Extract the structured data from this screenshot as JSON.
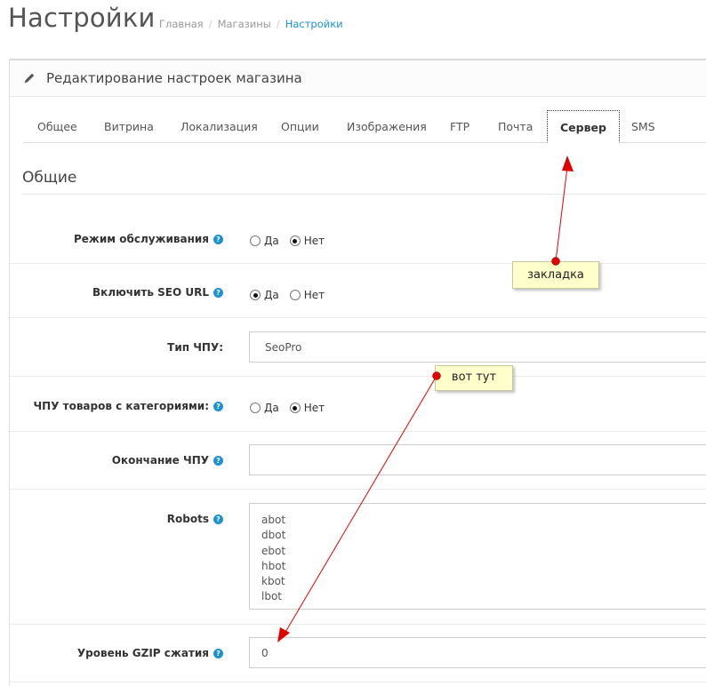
{
  "header": {
    "title": "Настройки",
    "breadcrumb": [
      "Главная",
      "Магазины",
      "Настройки"
    ],
    "breadcrumb_sep": "/"
  },
  "panel": {
    "title": "Редактирование настроек магазина",
    "icon": "pencil-icon"
  },
  "tabs": [
    {
      "label": "Общее"
    },
    {
      "label": "Витрина"
    },
    {
      "label": "Локализация"
    },
    {
      "label": "Опции"
    },
    {
      "label": "Изображения"
    },
    {
      "label": "FTP"
    },
    {
      "label": "Почта"
    },
    {
      "label": "Сервер",
      "active": true
    },
    {
      "label": "SMS"
    }
  ],
  "section": {
    "title": "Общие"
  },
  "fields": {
    "maintenance": {
      "label": "Режим обслуживания",
      "options": [
        "Да",
        "Нет"
      ],
      "selected": "Нет"
    },
    "seo_url": {
      "label": "Включить SEO URL",
      "options": [
        "Да",
        "Нет"
      ],
      "selected": "Да"
    },
    "url_type": {
      "label": "Тип ЧПУ:",
      "value": "SeoPro"
    },
    "product_cat_urls": {
      "label": "ЧПУ товаров с категориями:",
      "options": [
        "Да",
        "Нет"
      ],
      "selected": "Нет"
    },
    "url_ending": {
      "label": "Окончание ЧПУ",
      "value": ""
    },
    "robots": {
      "label": "Robots",
      "lines": [
        "abot",
        "dbot",
        "ebot",
        "hbot",
        "kbot",
        "lbot"
      ]
    },
    "gzip": {
      "label": "Уровень GZIP сжатия",
      "value": "0"
    }
  },
  "annotations": {
    "tab_note": "закладка",
    "here_note": "вот тут"
  },
  "colors": {
    "link": "#1e91cf",
    "arrow": "#e00000",
    "note_bg": "#ffffcc"
  }
}
